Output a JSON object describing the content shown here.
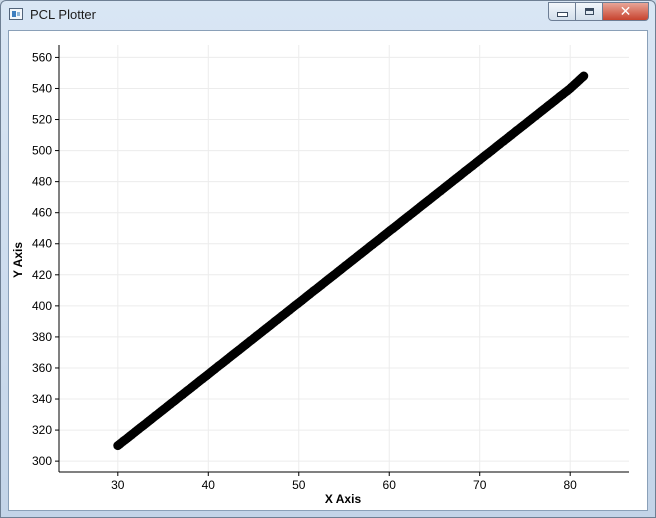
{
  "window": {
    "title": "PCL Plotter",
    "icons": {
      "app": "app-icon",
      "minimize": "minimize-icon",
      "maximize": "maximize-icon",
      "close": "close-icon"
    },
    "close_glyph": "✕"
  },
  "chart_data": {
    "type": "scatter",
    "xlabel": "X Axis",
    "ylabel": "Y Axis",
    "xlim": [
      23.5,
      86.5
    ],
    "ylim": [
      293,
      568
    ],
    "x_ticks": [
      30,
      40,
      50,
      60,
      70,
      80
    ],
    "y_ticks": [
      300,
      320,
      340,
      360,
      380,
      400,
      420,
      440,
      460,
      480,
      500,
      520,
      540,
      560
    ],
    "grid": true,
    "series": [
      {
        "color": "#000000",
        "x": [
          30,
          32,
          34,
          36,
          38,
          40,
          42,
          44,
          46,
          48,
          50,
          52,
          54,
          56,
          58,
          60,
          62,
          64,
          66,
          68,
          70,
          72,
          74,
          76,
          78,
          80,
          81.5
        ],
        "y": [
          310,
          319.2,
          328.4,
          337.6,
          346.8,
          356,
          365.2,
          374.4,
          383.6,
          392.8,
          402,
          411.2,
          420.4,
          429.6,
          438.8,
          448,
          457.2,
          466.4,
          475.6,
          484.8,
          494,
          503.2,
          512.4,
          521.6,
          530.8,
          540,
          548
        ]
      }
    ]
  }
}
